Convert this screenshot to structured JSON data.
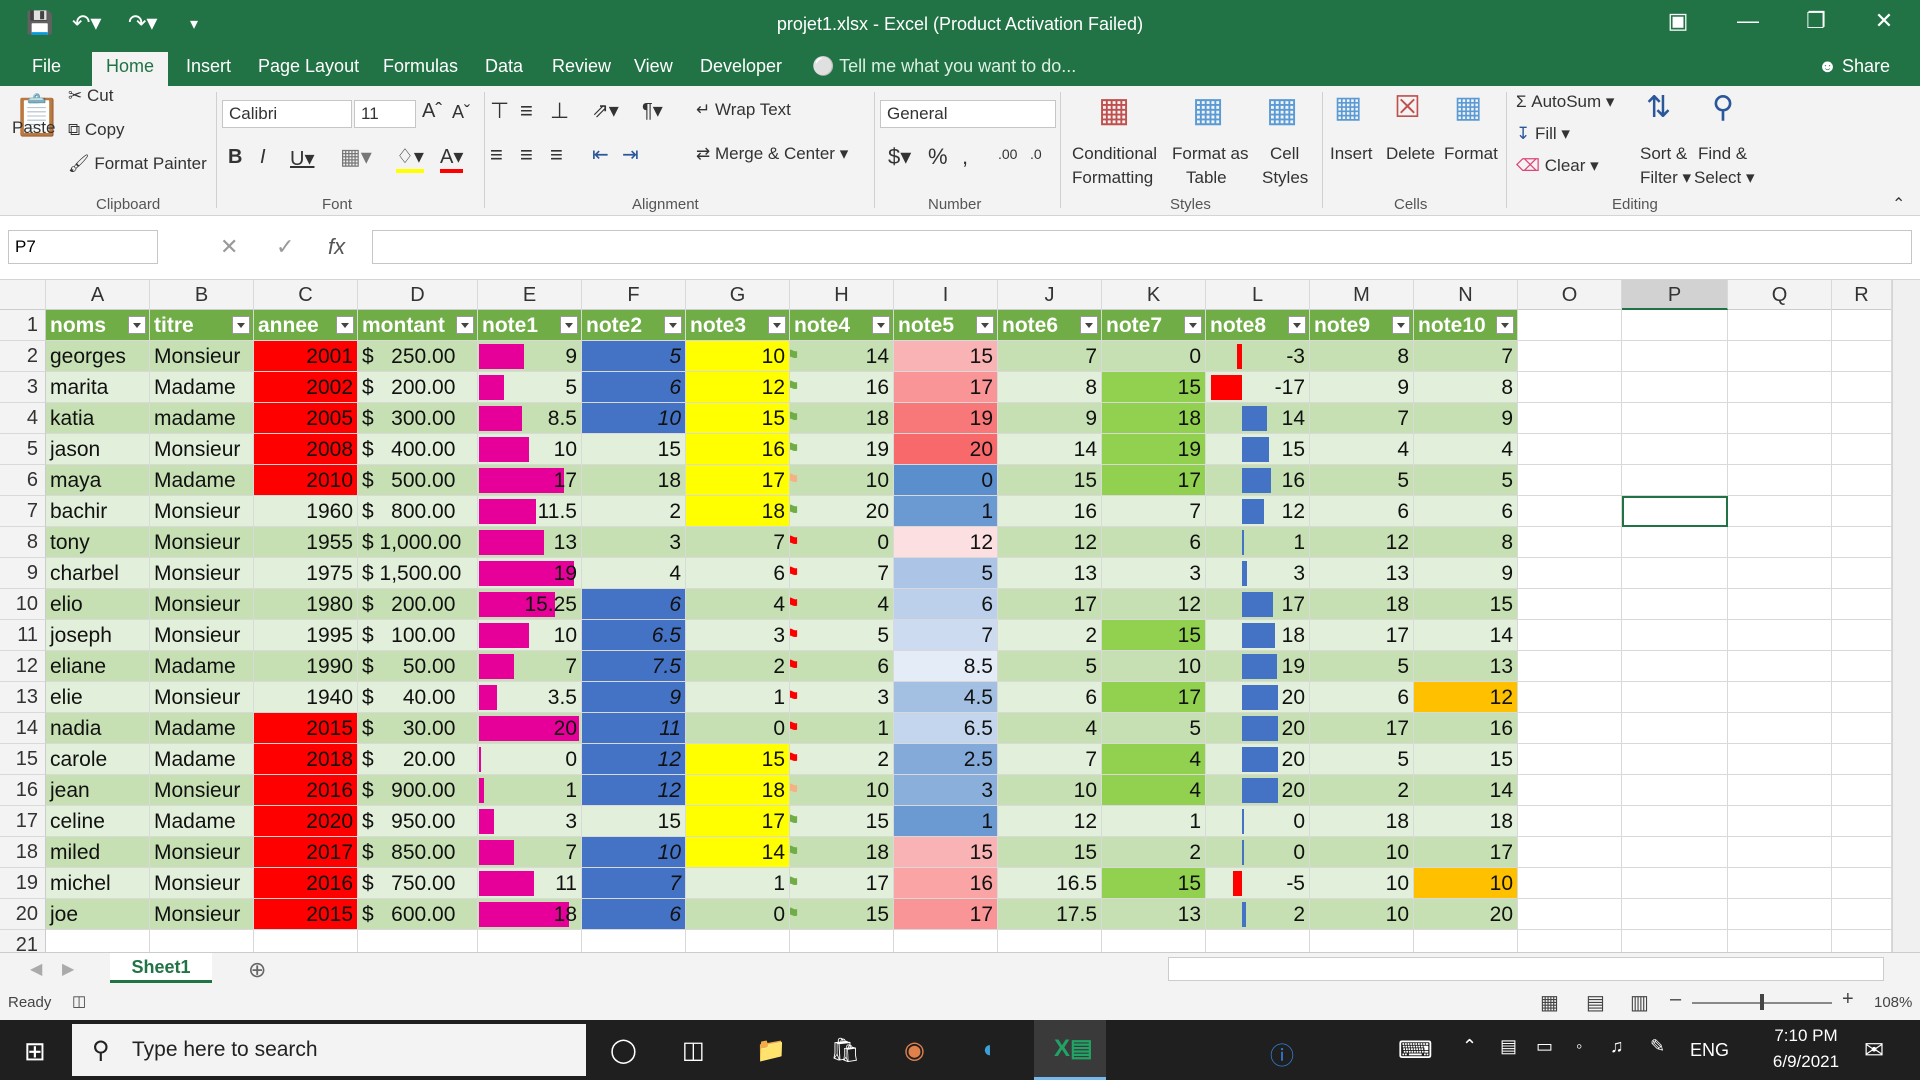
{
  "window": {
    "title": "projet1.xlsx - Excel (Product Activation Failed)"
  },
  "colors": {
    "brand": "#217346",
    "header_fill": "#70ad47",
    "red": "#ff0000",
    "yellow": "#ffff00",
    "blue": "#4472c4",
    "magenta": "#e60099",
    "green": "#92d050",
    "orange": "#ffc000"
  },
  "tabs": [
    "File",
    "Home",
    "Insert",
    "Page Layout",
    "Formulas",
    "Data",
    "Review",
    "View",
    "Developer"
  ],
  "tell_me": "Tell me what you want to do...",
  "share": "Share",
  "ribbon": {
    "paste": "Paste",
    "cut": "Cut",
    "copy": "Copy",
    "format_painter": "Format Painter",
    "clipboard": "Clipboard",
    "font_name": "Calibri",
    "font_size": "11",
    "font": "Font",
    "wrap_text": "Wrap Text",
    "merge_center": "Merge & Center",
    "alignment": "Alignment",
    "number_format": "General",
    "number": "Number",
    "conditional": "Conditional",
    "formatting": "Formatting",
    "format_as": "Format as",
    "table": "Table",
    "cell": "Cell",
    "styles_lbl": "Styles",
    "styles": "Styles",
    "insert": "Insert",
    "delete": "Delete",
    "format": "Format",
    "cells": "Cells",
    "autosum": "AutoSum",
    "fill": "Fill",
    "clear": "Clear",
    "sort": "Sort &",
    "filter": "Filter",
    "find": "Find &",
    "select": "Select",
    "editing": "Editing"
  },
  "name_box": "P7",
  "formula": "",
  "columns": [
    "A",
    "B",
    "C",
    "D",
    "E",
    "F",
    "G",
    "H",
    "I",
    "J",
    "K",
    "L",
    "M",
    "N",
    "O",
    "P",
    "Q",
    "R"
  ],
  "headers": [
    "noms",
    "titre",
    "annee",
    "montant",
    "note1",
    "note2",
    "note3",
    "note4",
    "note5",
    "note6",
    "note7",
    "note8",
    "note9",
    "note10"
  ],
  "rows": [
    [
      "georges",
      "Monsieur",
      "2001",
      "$   250.00",
      "9",
      "5",
      "10",
      "14",
      "15",
      "7",
      "0",
      "-3",
      "8",
      "7"
    ],
    [
      "marita",
      "Madame",
      "2002",
      "$   200.00",
      "5",
      "6",
      "12",
      "16",
      "17",
      "8",
      "15",
      "-17",
      "9",
      "8"
    ],
    [
      "katia",
      "madame",
      "2005",
      "$   300.00",
      "8.5",
      "10",
      "15",
      "18",
      "19",
      "9",
      "18",
      "14",
      "7",
      "9"
    ],
    [
      "jason",
      "Monsieur",
      "2008",
      "$   400.00",
      "10",
      "15",
      "16",
      "19",
      "20",
      "14",
      "19",
      "15",
      "4",
      "4"
    ],
    [
      "maya",
      "Madame",
      "2010",
      "$   500.00",
      "17",
      "18",
      "17",
      "10",
      "0",
      "15",
      "17",
      "16",
      "5",
      "5"
    ],
    [
      "bachir",
      "Monsieur",
      "1960",
      "$   800.00",
      "11.5",
      "2",
      "18",
      "20",
      "1",
      "16",
      "7",
      "12",
      "6",
      "6"
    ],
    [
      "tony",
      "Monsieur",
      "1955",
      "$ 1,000.00",
      "13",
      "3",
      "7",
      "0",
      "12",
      "12",
      "6",
      "1",
      "12",
      "8"
    ],
    [
      "charbel",
      "Monsieur",
      "1975",
      "$ 1,500.00",
      "19",
      "4",
      "6",
      "7",
      "5",
      "13",
      "3",
      "3",
      "13",
      "9"
    ],
    [
      "elio",
      "Monsieur",
      "1980",
      "$   200.00",
      "15.25",
      "6",
      "4",
      "4",
      "6",
      "17",
      "12",
      "17",
      "18",
      "15"
    ],
    [
      "joseph",
      "Monsieur",
      "1995",
      "$   100.00",
      "10",
      "6.5",
      "3",
      "5",
      "7",
      "2",
      "15",
      "18",
      "17",
      "14"
    ],
    [
      "eliane",
      "Madame",
      "1990",
      "$     50.00",
      "7",
      "7.5",
      "2",
      "6",
      "8.5",
      "5",
      "10",
      "19",
      "5",
      "13"
    ],
    [
      "elie",
      "Monsieur",
      "1940",
      "$     40.00",
      "3.5",
      "9",
      "1",
      "3",
      "4.5",
      "6",
      "17",
      "20",
      "6",
      "12"
    ],
    [
      "nadia",
      "Madame",
      "2015",
      "$     30.00",
      "20",
      "11",
      "0",
      "1",
      "6.5",
      "4",
      "5",
      "20",
      "17",
      "16"
    ],
    [
      "carole",
      "Madame",
      "2018",
      "$     20.00",
      "0",
      "12",
      "15",
      "2",
      "2.5",
      "7",
      "4",
      "20",
      "5",
      "15"
    ],
    [
      "jean",
      "Monsieur",
      "2016",
      "$   900.00",
      "1",
      "12",
      "18",
      "10",
      "3",
      "10",
      "4",
      "20",
      "2",
      "14"
    ],
    [
      "celine",
      "Madame",
      "2020",
      "$   950.00",
      "3",
      "15",
      "17",
      "15",
      "1",
      "12",
      "1",
      "0",
      "18",
      "18"
    ],
    [
      "miled",
      "Monsieur",
      "2017",
      "$   850.00",
      "7",
      "10",
      "14",
      "18",
      "15",
      "15",
      "2",
      "0",
      "10",
      "17"
    ],
    [
      "michel",
      "Monsieur",
      "2016",
      "$   750.00",
      "11",
      "7",
      "1",
      "17",
      "16",
      "16.5",
      "15",
      "-5",
      "10",
      "10"
    ],
    [
      "joe",
      "Monsieur",
      "2015",
      "$   600.00",
      "18",
      "6",
      "0",
      "15",
      "17",
      "17.5",
      "13",
      "2",
      "10",
      "20"
    ]
  ],
  "sheet": "Sheet1",
  "status": "Ready",
  "zoom": "108%",
  "taskbar": {
    "search": "Type here to search",
    "lang": "ENG",
    "time": "7:10 PM",
    "date": "6/9/2021"
  }
}
